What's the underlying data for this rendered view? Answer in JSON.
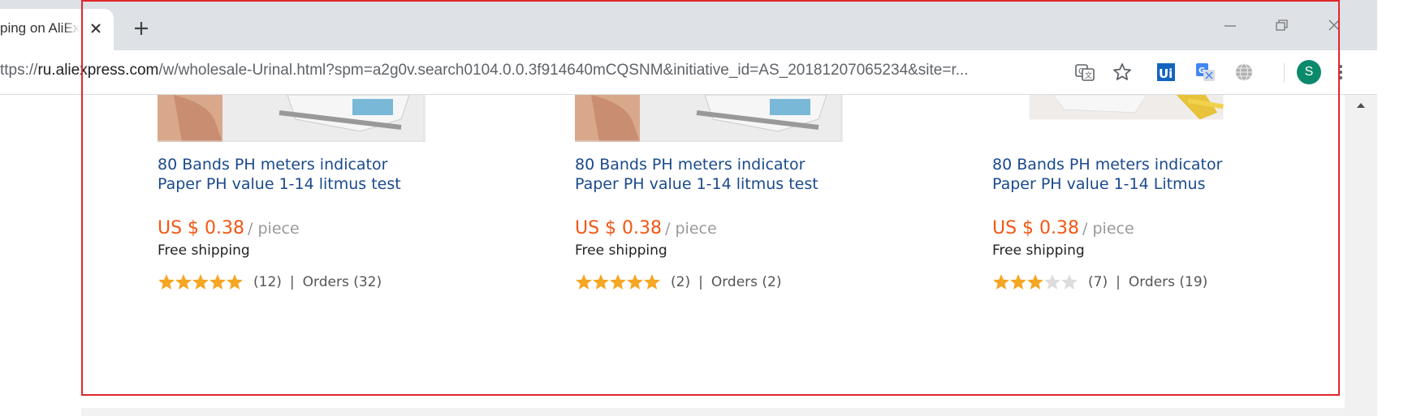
{
  "browser": {
    "tab_title": "ping on AliExpress",
    "url_prefix": "ttps://",
    "url_host": "ru.aliexpress.com",
    "url_path": "/w/wholesale-Urinal.html?spm=a2g0v.search0104.0.0.3f914640mCQSNM&initiative_id=AS_20181207065234&site=r...",
    "avatar_letter": "S",
    "ext_ui_label": "Ui"
  },
  "products": [
    {
      "title": "80 Bands PH meters indicator Paper PH value 1-14 litmus test",
      "price": "US $ 0.38",
      "unit": "/ piece",
      "shipping": "Free shipping",
      "rating": 5,
      "reviews": "(12)",
      "orders": "Orders (32)"
    },
    {
      "title": "80 Bands PH meters indicator Paper PH value 1-14 litmus test",
      "price": "US $ 0.38",
      "unit": "/ piece",
      "shipping": "Free shipping",
      "rating": 5,
      "reviews": "(2)",
      "orders": "Orders (2)"
    },
    {
      "title": "80 Bands PH meters indicator Paper PH value 1-14 Litmus",
      "price": "US $ 0.38",
      "unit": "/ piece",
      "shipping": "Free shipping",
      "rating": 3,
      "reviews": "(7)",
      "orders": "Orders (19)"
    }
  ],
  "colors": {
    "accent_price": "#f35614",
    "title_link": "#1a4a8c",
    "star_on": "#f5a623",
    "star_off": "#dddddd",
    "highlight": "#e0262a"
  },
  "icons": {
    "tab_close": "close-icon",
    "new_tab": "plus-icon",
    "minimize": "minimize-icon",
    "restore": "restore-icon",
    "close_window": "close-icon",
    "translate": "translate-icon",
    "bookmark": "star-icon",
    "menu": "kebab-menu-icon"
  }
}
